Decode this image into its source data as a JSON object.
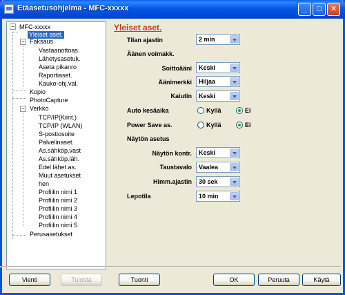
{
  "window": {
    "title": "Etäasetusohjelma - MFC-xxxxx",
    "min": "_",
    "max": "□",
    "close": "✕"
  },
  "tree": {
    "root": "MFC-xxxxx",
    "items": [
      {
        "label": "Yleiset aset.",
        "selected": true
      },
      {
        "label": "Faksaus"
      },
      {
        "label": "Vastaanottoas."
      },
      {
        "label": "Lähetysasetuk."
      },
      {
        "label": "Aseta pikanro"
      },
      {
        "label": "Raportiaset."
      },
      {
        "label": "Kauko-ohj.val."
      },
      {
        "label": "Kopio"
      },
      {
        "label": "PhotoCapture"
      },
      {
        "label": "Verkko"
      },
      {
        "label": "TCP/IP(Kiint.)"
      },
      {
        "label": "TCP/IP (WLAN)"
      },
      {
        "label": "S-postiosoite"
      },
      {
        "label": "Palvelinaset."
      },
      {
        "label": "As.sähköp.vast"
      },
      {
        "label": "As.sähköp.läh."
      },
      {
        "label": "Edel.lähet.as."
      },
      {
        "label": "Muut asetukset"
      },
      {
        "label": "hen"
      },
      {
        "label": "Profiilin nimi 1"
      },
      {
        "label": "Profiilin nimi 2"
      },
      {
        "label": "Profiilin nimi 3"
      },
      {
        "label": "Profiilin nimi 4"
      },
      {
        "label": "Profiilin nimi 5"
      },
      {
        "label": "Perusasetukset"
      }
    ]
  },
  "main": {
    "section_title": "Yleiset aset.",
    "tilan_ajastin": {
      "label": "Tilan ajastin",
      "value": "2 min"
    },
    "volume_header": "Äänen voimakk.",
    "soittoaani": {
      "label": "Soittoääni",
      "value": "Keski"
    },
    "aanimerkki": {
      "label": "Äänimerkki",
      "value": "Hiljaa"
    },
    "kaiutin": {
      "label": "Kaiutin",
      "value": "Keski"
    },
    "auto_kesaaika": {
      "label": "Auto kesäaika",
      "opt_yes": "Kyllä",
      "opt_no": "Ei",
      "selected": "Ei"
    },
    "power_save": {
      "label": "Power Save as.",
      "opt_yes": "Kyllä",
      "opt_no": "Ei",
      "selected": "Ei"
    },
    "display_header": "Näytön asetus",
    "nayton_kontr": {
      "label": "Näytön kontr.",
      "value": "Keski"
    },
    "taustavalo": {
      "label": "Taustavalo",
      "value": "Vaalea"
    },
    "himm_ajastin": {
      "label": "Himm.ajastin",
      "value": "30 sek"
    },
    "lepotila": {
      "label": "Lepotila",
      "value": "10 min"
    }
  },
  "buttons": {
    "vienti": "Vienti",
    "tulosta": "Tulosta",
    "tuonti": "Tuonti",
    "ok": "OK",
    "peruuta": "Peruuta",
    "kayta": "Käytä"
  }
}
